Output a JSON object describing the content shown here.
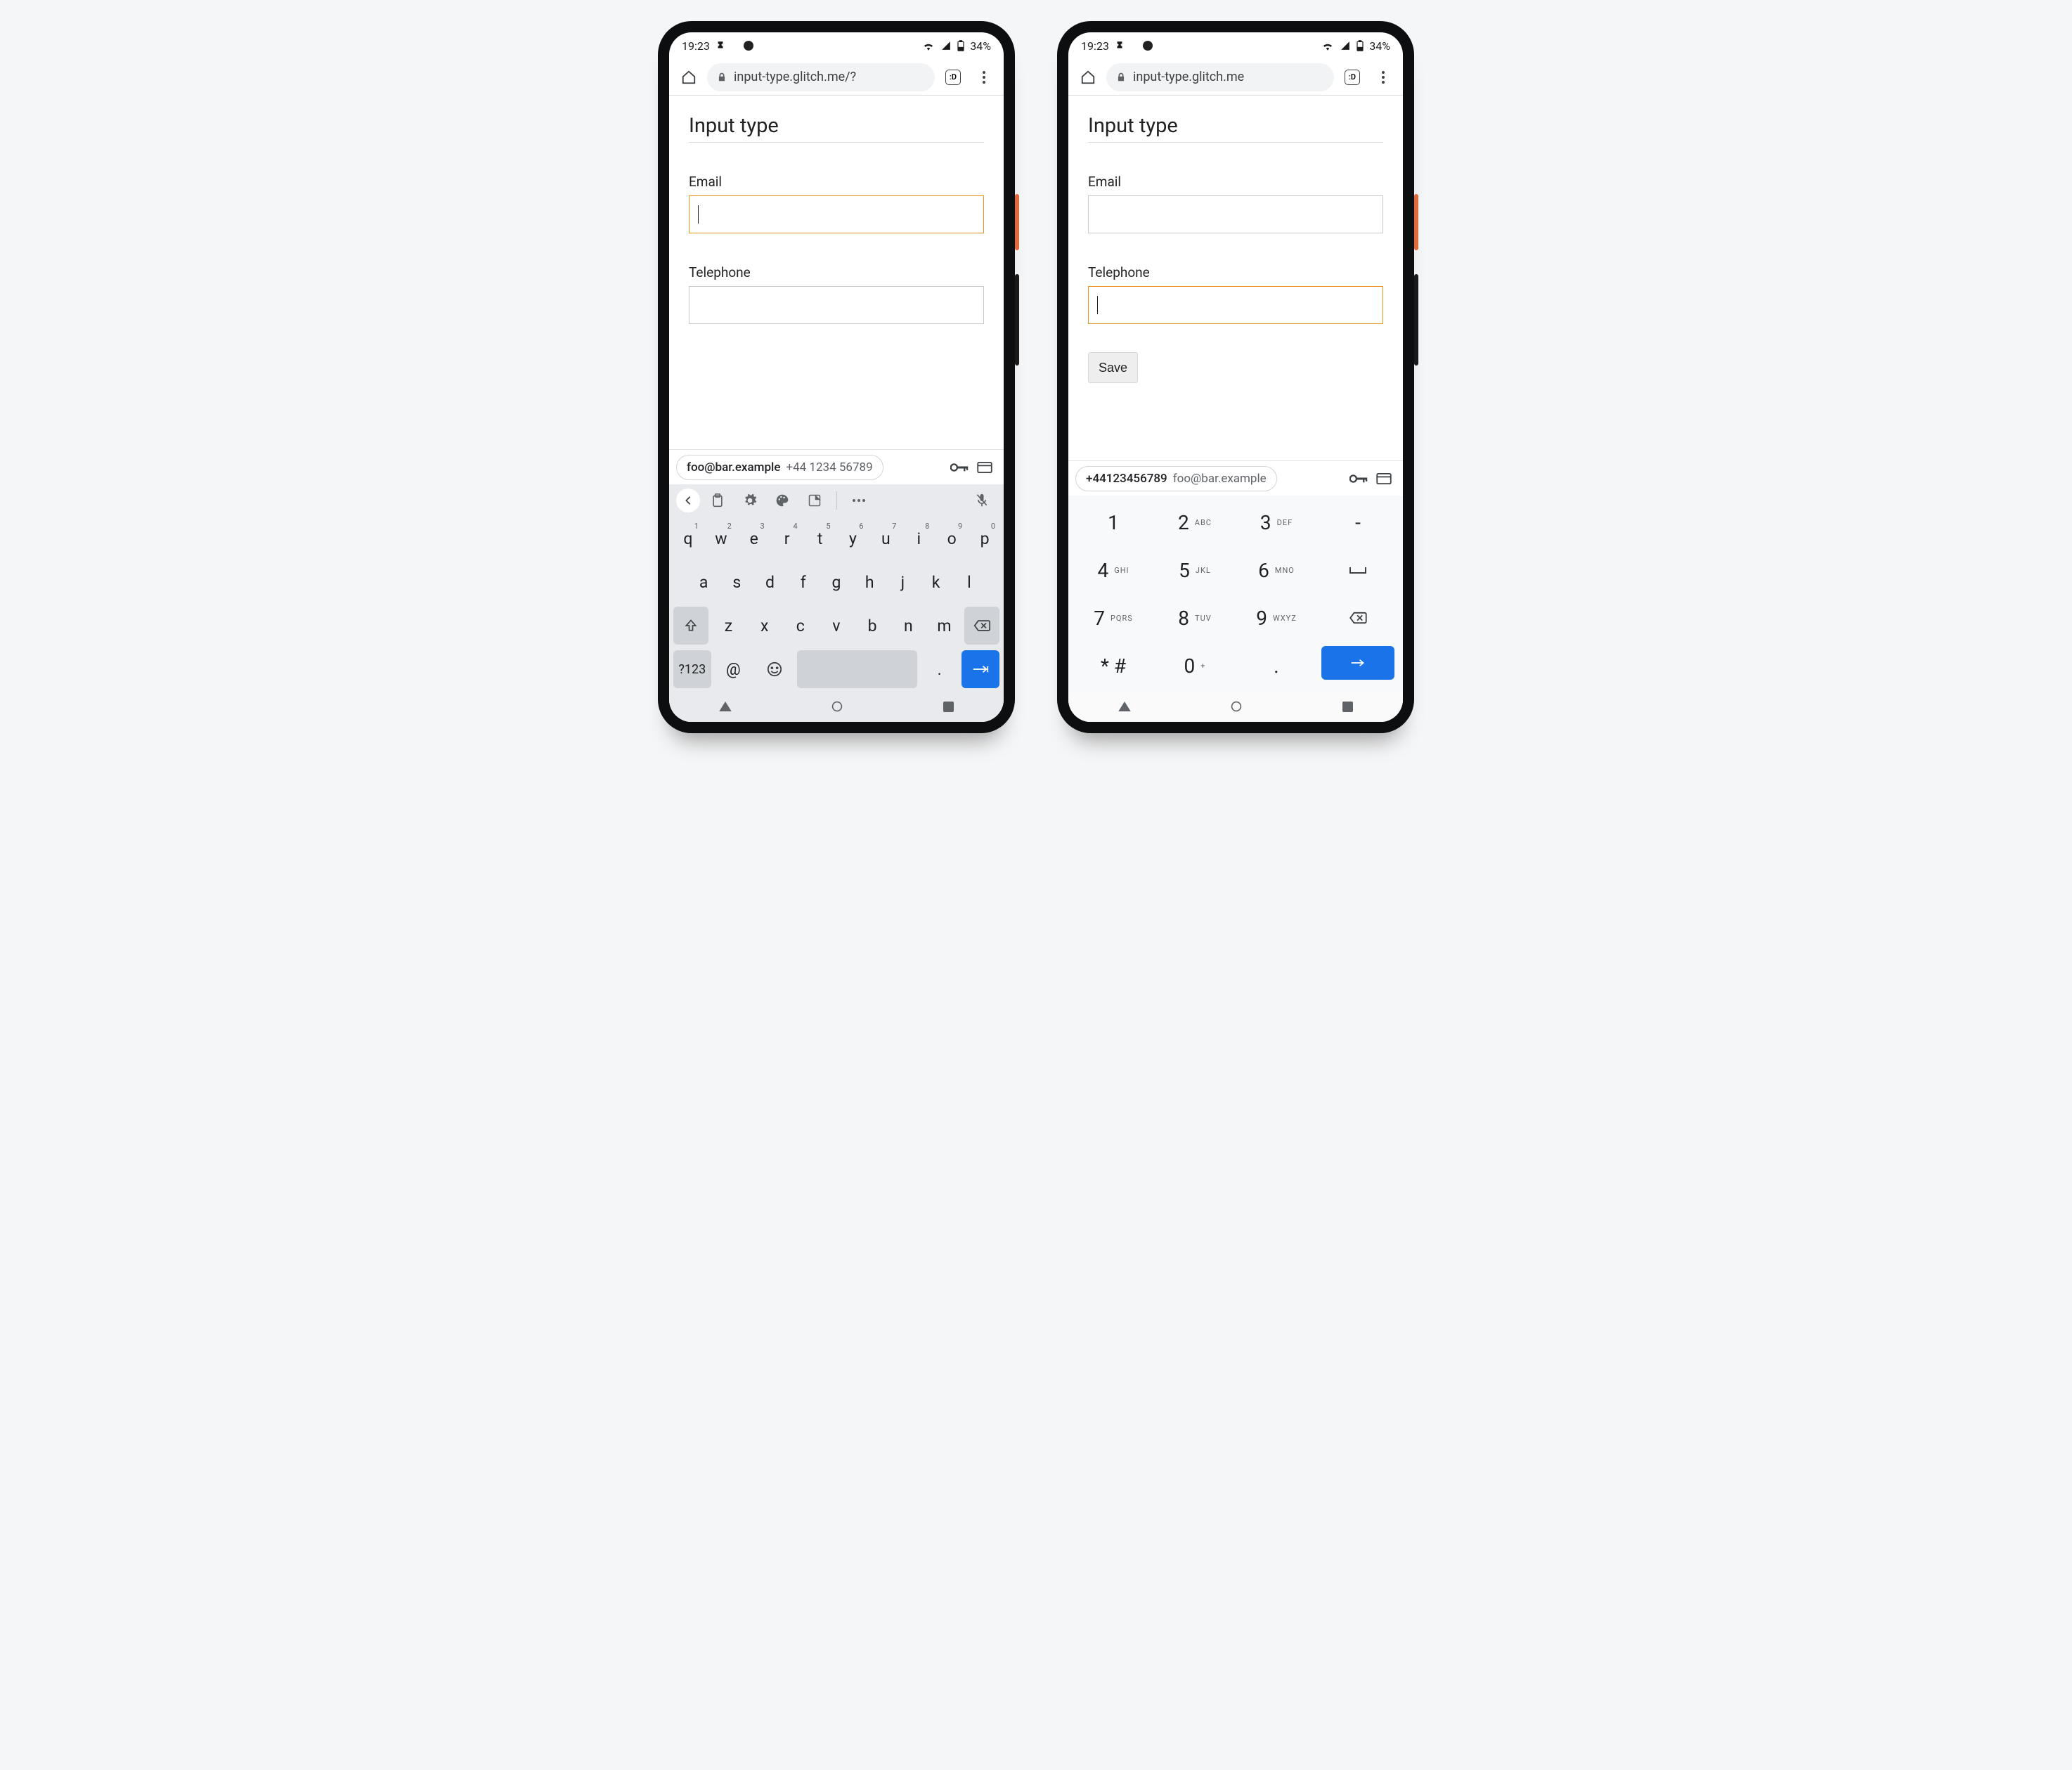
{
  "statusbar": {
    "time": "19:23",
    "battery": "34%"
  },
  "browser": {
    "url_left": "input-type.glitch.me/?",
    "url_right": "input-type.glitch.me",
    "tab_label": ":D"
  },
  "page": {
    "heading": "Input type",
    "email_label": "Email",
    "telephone_label": "Telephone",
    "save_label": "Save"
  },
  "autofill": {
    "email": "foo@bar.example",
    "phone": "+44 1234 56789",
    "phone_compact": "+44123456789"
  },
  "qwerty": {
    "row1": [
      {
        "k": "q",
        "n": "1"
      },
      {
        "k": "w",
        "n": "2"
      },
      {
        "k": "e",
        "n": "3"
      },
      {
        "k": "r",
        "n": "4"
      },
      {
        "k": "t",
        "n": "5"
      },
      {
        "k": "y",
        "n": "6"
      },
      {
        "k": "u",
        "n": "7"
      },
      {
        "k": "i",
        "n": "8"
      },
      {
        "k": "o",
        "n": "9"
      },
      {
        "k": "p",
        "n": "0"
      }
    ],
    "row2": [
      "a",
      "s",
      "d",
      "f",
      "g",
      "h",
      "j",
      "k",
      "l"
    ],
    "row3": [
      "z",
      "x",
      "c",
      "v",
      "b",
      "n",
      "m"
    ],
    "sym_label": "?123",
    "at": "@",
    "period": "."
  },
  "numpad": {
    "keys": [
      {
        "d": "1",
        "l": ""
      },
      {
        "d": "2",
        "l": "ABC"
      },
      {
        "d": "3",
        "l": "DEF"
      },
      {
        "d": "-",
        "l": ""
      },
      {
        "d": "4",
        "l": "GHI"
      },
      {
        "d": "5",
        "l": "JKL"
      },
      {
        "d": "6",
        "l": "MNO"
      },
      {
        "d": "␣",
        "l": ""
      },
      {
        "d": "7",
        "l": "PQRS"
      },
      {
        "d": "8",
        "l": "TUV"
      },
      {
        "d": "9",
        "l": "WXYZ"
      },
      {
        "d": "⌫",
        "l": ""
      },
      {
        "d": "* #",
        "l": ""
      },
      {
        "d": "0",
        "l": "+"
      },
      {
        "d": ".",
        "l": ""
      },
      {
        "d": "→",
        "l": ""
      }
    ]
  }
}
